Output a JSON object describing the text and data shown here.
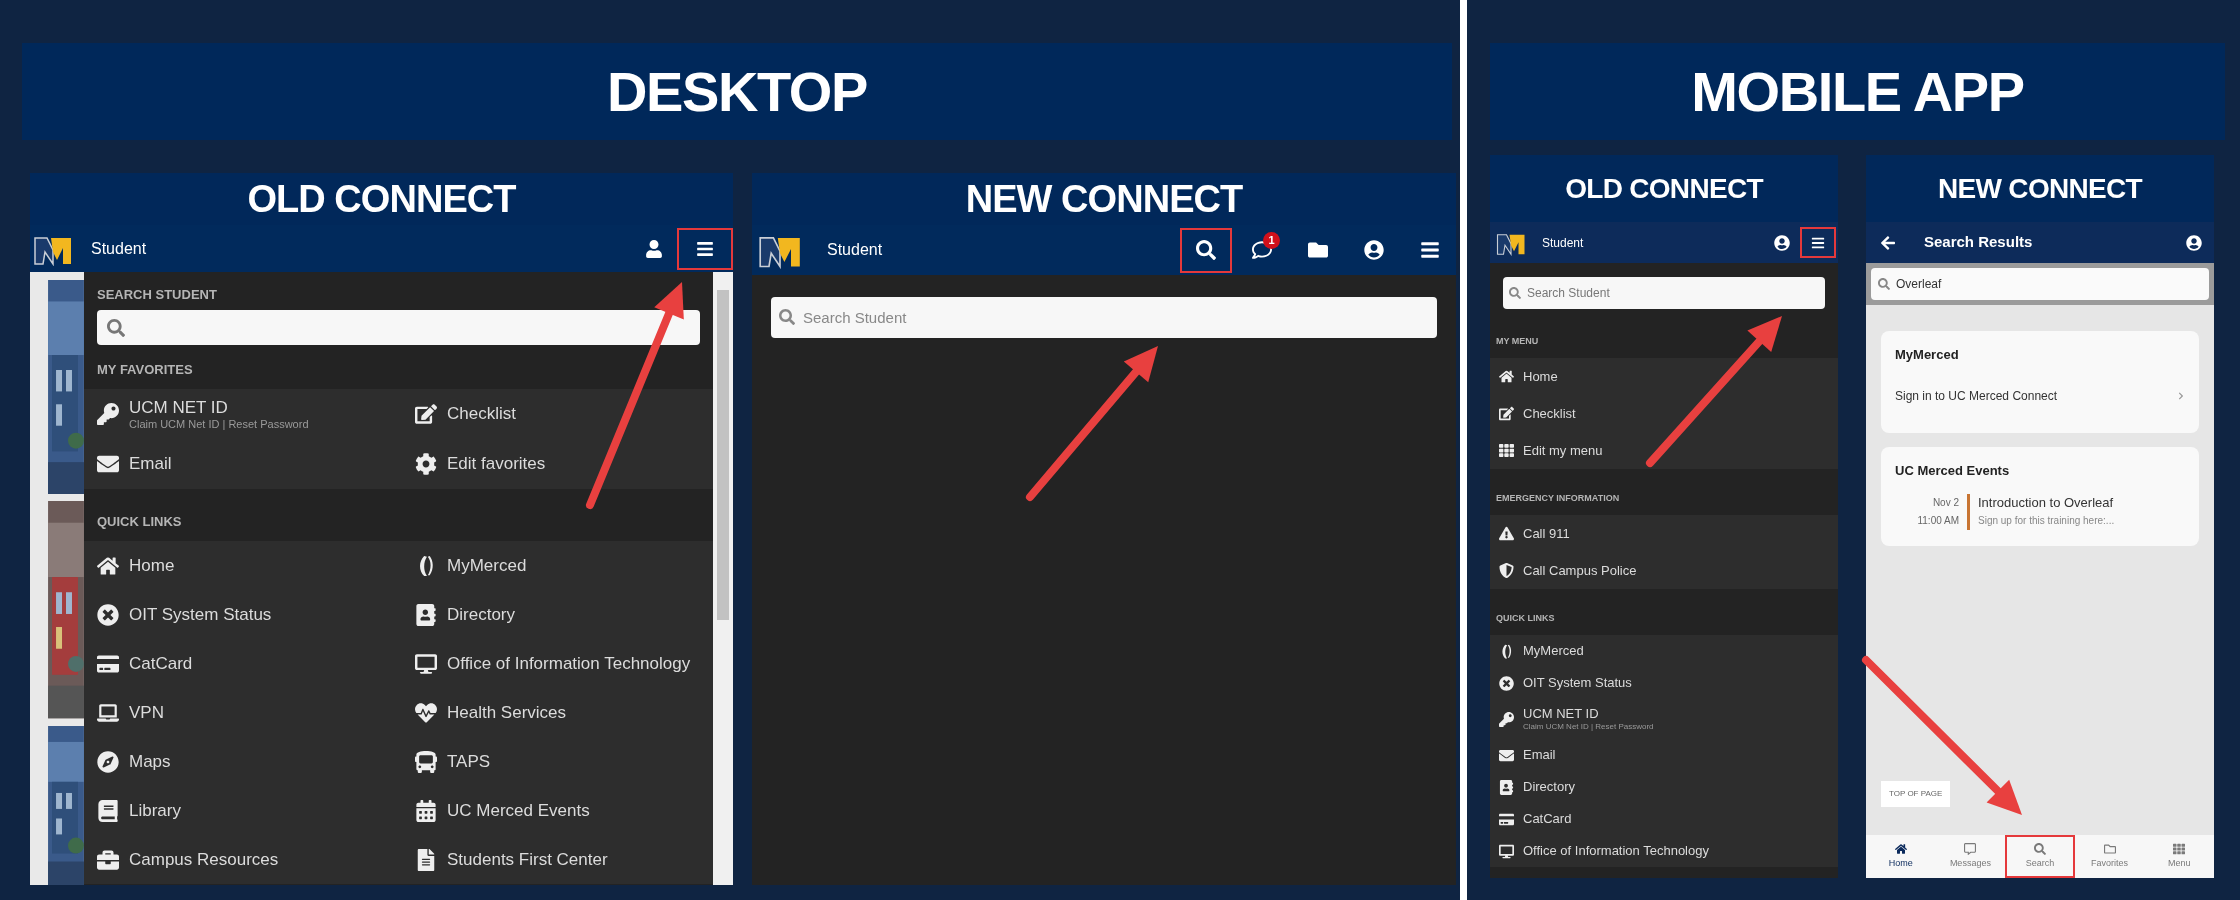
{
  "sections": [
    {
      "title": "DESKTOP",
      "panels": [
        {
          "kind": "desktop_old",
          "title": "OLD CONNECT",
          "app_title": "Student",
          "header_buttons": [
            {
              "highlighted": false
            },
            {
              "highlighted": true
            }
          ],
          "search_label": "SEARCH STUDENT",
          "groups": [
            {
              "heading": "MY FAVORITES",
              "items": [
                {
                  "label": "UCM NET ID",
                  "sub": "Claim UCM Net ID | Reset Password"
                },
                {
                  "label": "Checklist"
                },
                {
                  "label": "Email"
                },
                {
                  "label": "Edit favorites"
                }
              ]
            },
            {
              "heading": "QUICK LINKS",
              "items": [
                {
                  "label": "Home"
                },
                {
                  "label": "MyMerced"
                },
                {
                  "label": "OIT System Status"
                },
                {
                  "label": "Directory"
                },
                {
                  "label": "CatCard"
                },
                {
                  "label": "Office of Information Technology"
                },
                {
                  "label": "VPN"
                },
                {
                  "label": "Health Services"
                },
                {
                  "label": "Maps"
                },
                {
                  "label": "TAPS"
                },
                {
                  "label": "Library"
                },
                {
                  "label": "UC Merced Events"
                },
                {
                  "label": "Campus Resources"
                },
                {
                  "label": "Students First Center"
                }
              ]
            }
          ]
        },
        {
          "kind": "desktop_new",
          "title": "NEW CONNECT",
          "app_title": "Student",
          "header_buttons": [
            {
              "highlighted": true
            },
            {
              "highlighted": false,
              "badge": "1"
            },
            {
              "highlighted": false
            },
            {
              "highlighted": false
            },
            {
              "highlighted": false
            }
          ],
          "search": {
            "placeholder": "Search Student"
          }
        }
      ]
    },
    {
      "title": "MOBILE APP",
      "panels": [
        {
          "kind": "mobile_old",
          "title": "OLD CONNECT",
          "app_title": "Student",
          "header_buttons": [
            {
              "highlighted": false
            },
            {
              "highlighted": true
            }
          ],
          "search": {
            "placeholder": "Search Student"
          },
          "groups": [
            {
              "heading": "MY MENU",
              "items": [
                {
                  "label": "Home"
                },
                {
                  "label": "Checklist"
                },
                {
                  "label": "Edit my menu"
                }
              ]
            },
            {
              "heading": "EMERGENCY INFORMATION",
              "items": [
                {
                  "label": "Call 911"
                },
                {
                  "label": "Call Campus Police"
                }
              ]
            },
            {
              "heading": "QUICK LINKS",
              "items": [
                {
                  "label": "MyMerced"
                },
                {
                  "label": "OIT System Status"
                },
                {
                  "label": "UCM NET ID",
                  "sub": "Claim UCM Net ID | Reset Password"
                },
                {
                  "label": "Email"
                },
                {
                  "label": "Directory"
                },
                {
                  "label": "CatCard"
                },
                {
                  "label": "Office of Information Technology"
                }
              ]
            }
          ]
        },
        {
          "kind": "mobile_new",
          "title": "NEW CONNECT",
          "app_title": "Search Results",
          "search": {
            "value": "Overleaf"
          },
          "cards": [
            {
              "title": "MyMerced",
              "link": "Sign in to UC Merced Connect"
            },
            {
              "title": "UC Merced Events",
              "event": {
                "date": "Nov 2",
                "time": "11:00 AM",
                "name": "Introduction to Overleaf",
                "description": "Sign up for this training here:..."
              }
            }
          ],
          "top_button": "TOP OF PAGE",
          "nav": [
            {
              "label": "Home",
              "selected": true,
              "highlighted": false
            },
            {
              "label": "Messages",
              "selected": false,
              "highlighted": false
            },
            {
              "label": "Search",
              "selected": false,
              "highlighted": true
            },
            {
              "label": "Favorites",
              "selected": false,
              "highlighted": false
            },
            {
              "label": "Menu",
              "selected": false,
              "highlighted": false
            }
          ]
        }
      ]
    }
  ]
}
